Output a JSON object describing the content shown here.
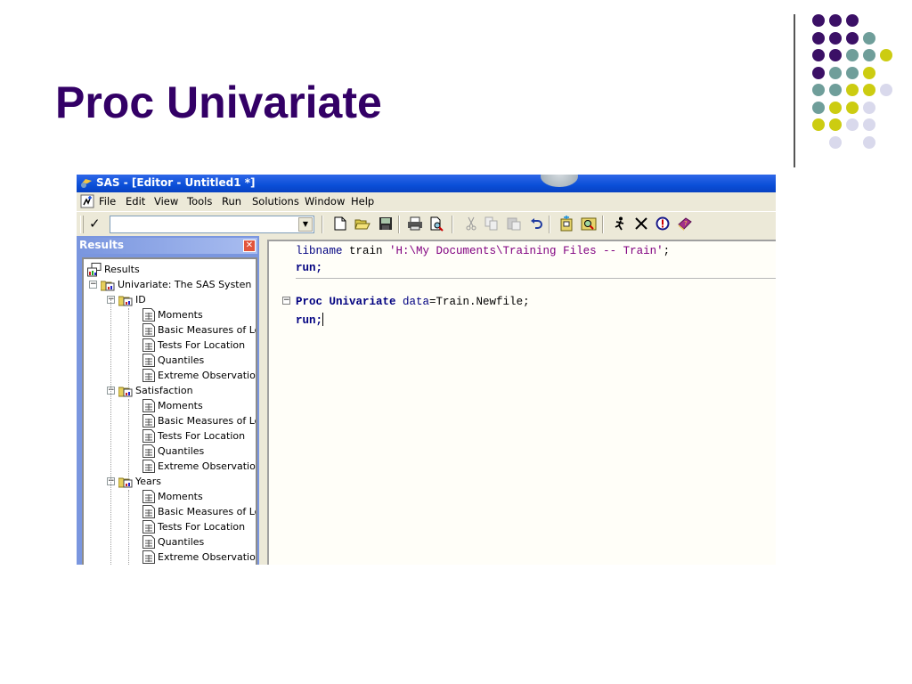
{
  "slide": {
    "title": "Proc Univariate",
    "accent_color": "#330066",
    "dot_colors": {
      "purple": "#3b1066",
      "teal": "#6f9e9a",
      "yellow": "#cccc11",
      "lavender": "#d9d9ec"
    }
  },
  "window": {
    "title": "SAS - [Editor - Untitled1 *]",
    "icon": "sas-logo-icon"
  },
  "menu": {
    "items": [
      "File",
      "Edit",
      "View",
      "Tools",
      "Run",
      "Solutions",
      "Window",
      "Help"
    ]
  },
  "toolbar": {
    "command_value": "",
    "buttons": [
      {
        "name": "new-icon"
      },
      {
        "name": "open-icon"
      },
      {
        "name": "save-icon"
      },
      {
        "name": "print-icon"
      },
      {
        "name": "print-preview-icon"
      },
      {
        "name": "cut-icon"
      },
      {
        "name": "copy-icon"
      },
      {
        "name": "paste-icon"
      },
      {
        "name": "undo-icon"
      },
      {
        "name": "new-library-icon"
      },
      {
        "name": "explorer-icon"
      },
      {
        "name": "submit-run-icon"
      },
      {
        "name": "clear-icon"
      },
      {
        "name": "break-icon"
      },
      {
        "name": "help-book-icon"
      }
    ]
  },
  "results": {
    "title": "Results",
    "root": "Results",
    "procedure": "Univariate:  The SAS System",
    "groups": [
      {
        "name": "ID",
        "items": [
          "Moments",
          "Basic Measures of Location and Variability",
          "Tests For Location",
          "Quantiles",
          "Extreme Observations"
        ]
      },
      {
        "name": "Satisfaction",
        "items": [
          "Moments",
          "Basic Measures of Location and Variability",
          "Tests For Location",
          "Quantiles",
          "Extreme Observations"
        ]
      },
      {
        "name": "Years",
        "items": [
          "Moments",
          "Basic Measures of Location and Variability",
          "Tests For Location",
          "Quantiles",
          "Extreme Observations"
        ]
      }
    ],
    "visible_labels": {
      "procedure": "Univariate:  The SAS Systen",
      "basic": "Basic Measures of Lo",
      "extreme": "Extreme Observatio"
    }
  },
  "editor": {
    "lines": [
      {
        "kw": "libname",
        "plain": " train ",
        "str": "'H:\\My Documents\\Training Files -- Train'",
        "end": ";"
      },
      {
        "kwb": "run",
        "end": ";"
      },
      {
        "kwb": "Proc Univariate",
        "kw": " data",
        "plain": "=Train.Newfile;"
      },
      {
        "kwb": "run",
        "end": ";"
      }
    ]
  }
}
